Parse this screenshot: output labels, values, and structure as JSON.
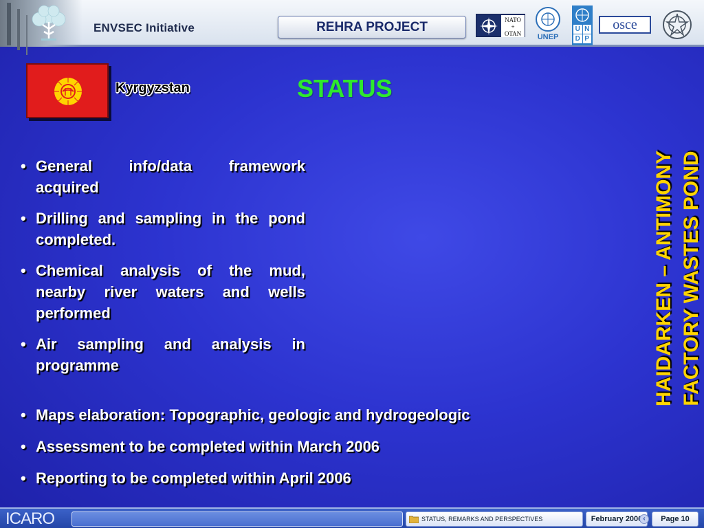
{
  "header": {
    "brand": "ENVSEC Initiative",
    "project": "REHRA PROJECT",
    "partners": {
      "nato_line1": "NATO",
      "nato_line2": "+",
      "nato_line3": "OTAN",
      "unep": "UNEP",
      "undp": [
        "U",
        "N",
        "D",
        "P"
      ],
      "osce": "osce"
    }
  },
  "slide": {
    "country": "Kyrgyzstan",
    "title": "STATUS",
    "side_title_line1": "HAIDARKEN – ANTIMONY",
    "side_title_line2": "FACTORY WASTES POND",
    "bullets_top": [
      "General info/data framework acquired",
      "Drilling and sampling in the pond completed.",
      "Chemical analysis of the mud, nearby river waters and wells performed",
      "Air sampling and analysis in programme"
    ],
    "bullets_bottom": [
      "Maps elaboration: Topographic, geologic and hydrogeologic",
      "Assessment to be completed within March 2006",
      "Reporting to be completed within April 2006"
    ]
  },
  "footer": {
    "brand": "ICARO",
    "section": "Status, remarks and perspectives",
    "date": "February 2006",
    "page_label": "Page",
    "page_number": "10"
  },
  "colors": {
    "background": "#2c33cf",
    "title_green": "#2ee82e",
    "side_title_yellow": "#ffd400",
    "flag_red": "#e11c1c"
  },
  "icons": [
    "tree-logo-icon",
    "nato-star-icon",
    "un-emblem-icon",
    "italy-emblem-icon",
    "kyrgyz-sun-icon",
    "folder-icon",
    "chevron-left-icon"
  ]
}
